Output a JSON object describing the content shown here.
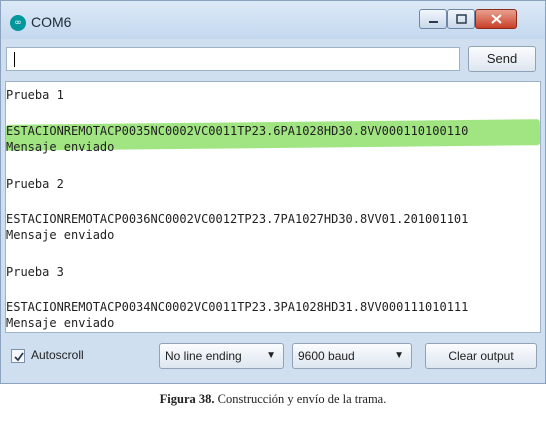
{
  "window": {
    "title": "COM6",
    "logo_symbol": "∞",
    "logo_color": "#00979c",
    "close_color": "#c9402a"
  },
  "send_row": {
    "input_value": "",
    "send_label": "Send"
  },
  "output": {
    "lines": [
      "Prueba 1",
      "ESTACIONREMOTACP0035NC0002VC0011TP23.6PA1028HD30.8VV000110100110",
      "Mensaje enviado",
      "Prueba 2",
      "ESTACIONREMOTACP0036NC0002VC0012TP23.7PA1027HD30.8VV01.201001101",
      "Mensaje enviado",
      "Prueba 3",
      "ESTACIONREMOTACP0034NC0002VC0011TP23.3PA1028HD31.8VV000111010111",
      "Mensaje enviado"
    ],
    "highlight_color": "#82dc5a"
  },
  "bottom_bar": {
    "autoscroll_label": "Autoscroll",
    "autoscroll_checked": true,
    "line_ending_value": "No line ending",
    "baud_value": "9600 baud",
    "clear_label": "Clear output"
  },
  "caption": {
    "label": "Figura 38.",
    "text": " Construcción y envío de la trama."
  }
}
